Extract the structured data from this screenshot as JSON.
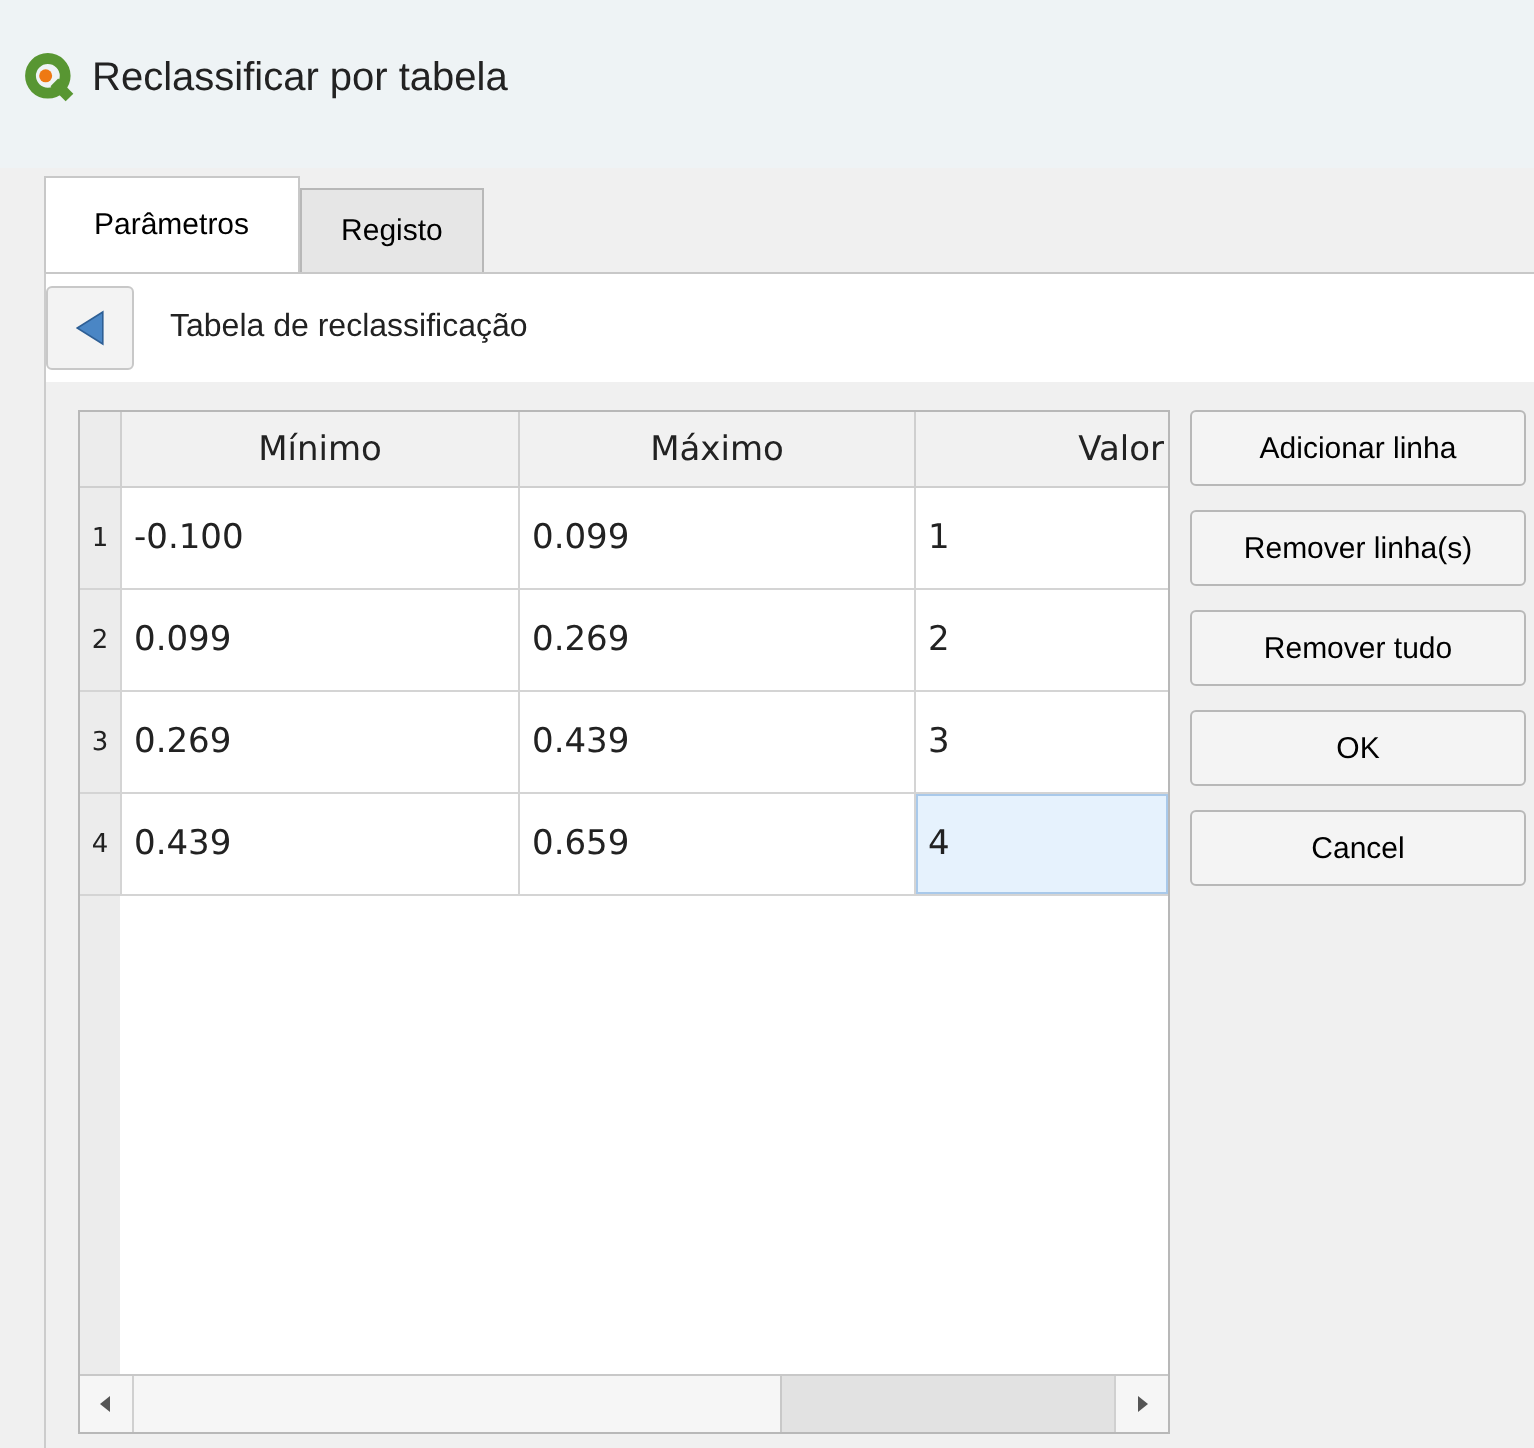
{
  "window": {
    "title": "Reclassificar por tabela"
  },
  "tabs": [
    {
      "label": "Parâmetros",
      "selected": true
    },
    {
      "label": "Registo",
      "selected": false
    }
  ],
  "section": {
    "title": "Tabela de reclassificação"
  },
  "table": {
    "columns": [
      "Mínimo",
      "Máximo",
      "Valor"
    ],
    "rows": [
      {
        "index": "1",
        "cells": [
          {
            "text": "-0.100",
            "selected": false
          },
          {
            "text": "0.099",
            "selected": false
          },
          {
            "text": "1",
            "selected": false
          }
        ]
      },
      {
        "index": "2",
        "cells": [
          {
            "text": "0.099",
            "selected": false
          },
          {
            "text": "0.269",
            "selected": false
          },
          {
            "text": "2",
            "selected": false
          }
        ]
      },
      {
        "index": "3",
        "cells": [
          {
            "text": "0.269",
            "selected": false
          },
          {
            "text": "0.439",
            "selected": false
          },
          {
            "text": "3",
            "selected": false
          }
        ]
      },
      {
        "index": "4",
        "cells": [
          {
            "text": "0.439",
            "selected": false
          },
          {
            "text": "0.659",
            "selected": false
          },
          {
            "text": "4",
            "selected": true
          }
        ]
      }
    ]
  },
  "buttons": [
    "Adicionar linha",
    "Remover linha(s)",
    "Remover tudo",
    "OK",
    "Cancel"
  ]
}
